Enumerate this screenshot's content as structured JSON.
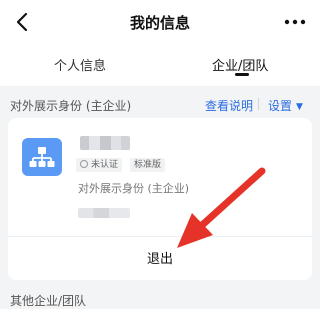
{
  "header": {
    "title": "我的信息"
  },
  "tabs": [
    {
      "label": "个人信息"
    },
    {
      "label": "企业/团队"
    }
  ],
  "section": {
    "label": "对外展示身份 (主企业)",
    "view_desc": "查看说明",
    "settings": "设置"
  },
  "card": {
    "badge_unverified": "未认证",
    "badge_standard": "标准版",
    "subtitle": "对外展示身份 (主企业)",
    "logout": "退出"
  },
  "other": {
    "label": "其他企业/团队"
  },
  "colors": {
    "accent": "#2b6de0",
    "org_icon": "#5a9af4",
    "arrow": "#e6332a"
  }
}
